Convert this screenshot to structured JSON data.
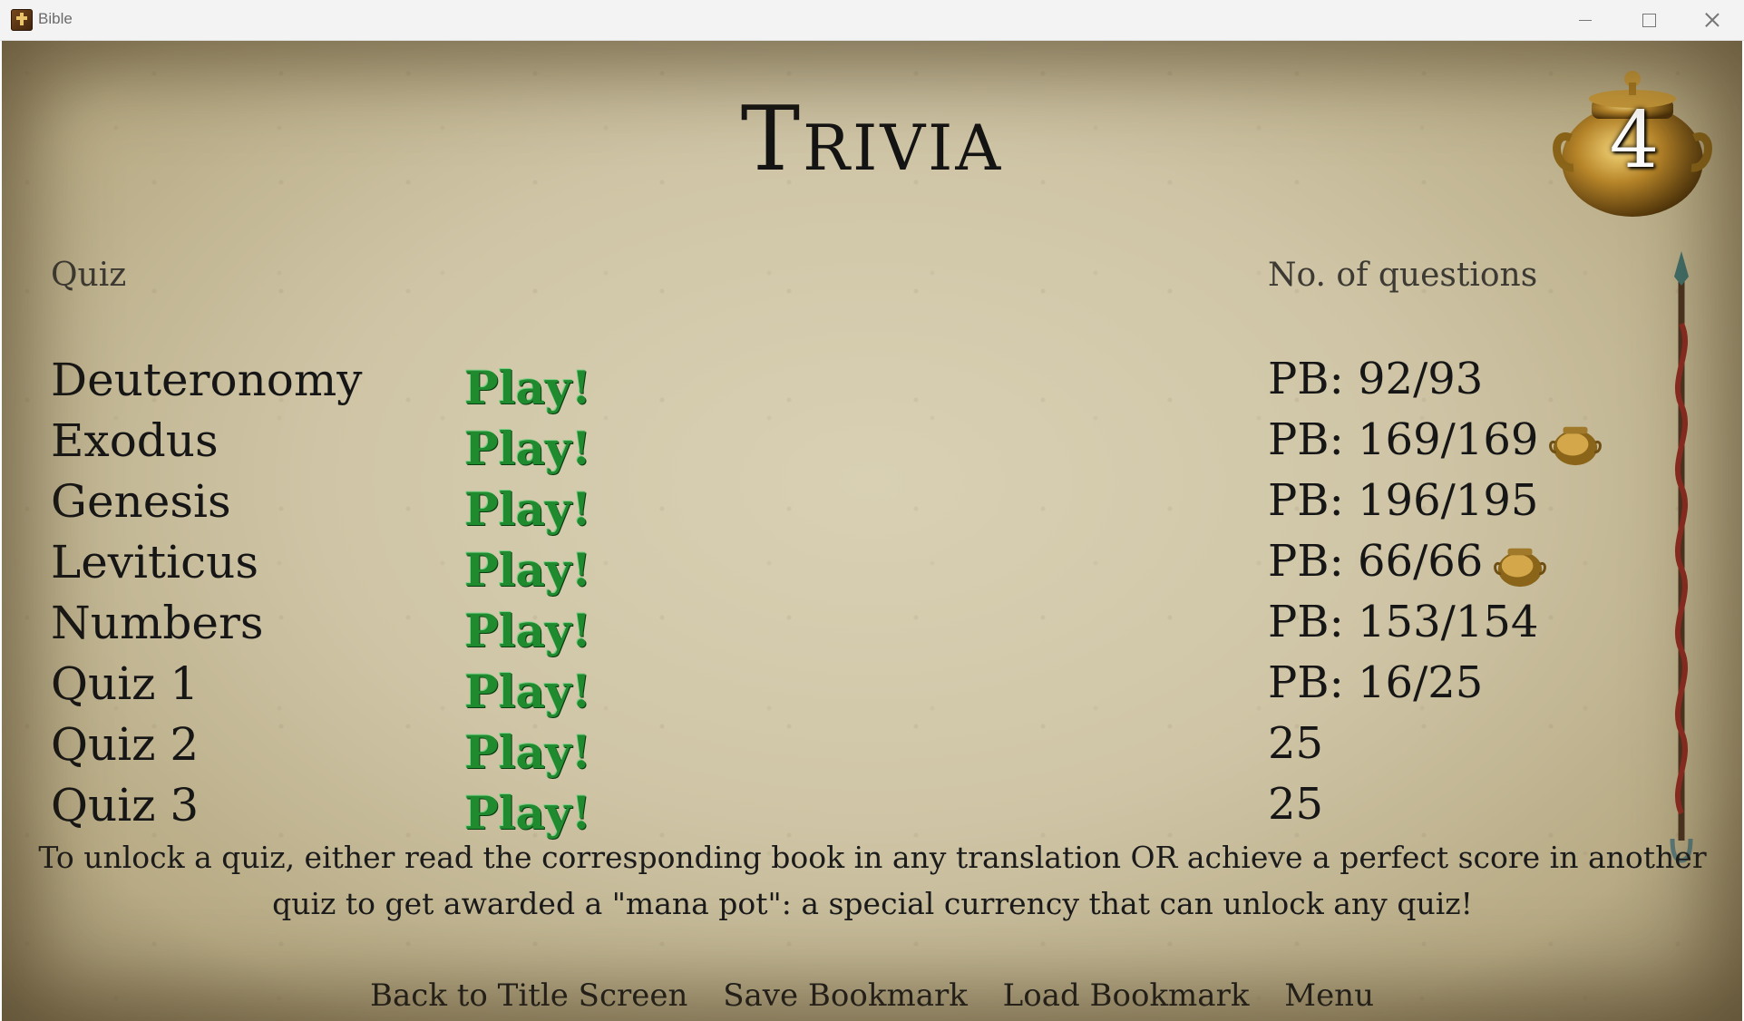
{
  "window": {
    "title": "Bible"
  },
  "screen": {
    "title": "Trivia",
    "mana_pot_count": "4"
  },
  "table": {
    "headers": {
      "quiz": "Quiz",
      "questions": "No. of questions"
    },
    "play_label": "Play!",
    "rows": [
      {
        "name": "Deuteronomy",
        "score": "PB: 92/93",
        "mana_pot_earned": false
      },
      {
        "name": "Exodus",
        "score": "PB: 169/169",
        "mana_pot_earned": true
      },
      {
        "name": "Genesis",
        "score": "PB: 196/195",
        "mana_pot_earned": false
      },
      {
        "name": "Leviticus",
        "score": "PB: 66/66",
        "mana_pot_earned": true
      },
      {
        "name": "Numbers",
        "score": "PB: 153/154",
        "mana_pot_earned": false
      },
      {
        "name": "Quiz 1",
        "score": "PB: 16/25",
        "mana_pot_earned": false
      },
      {
        "name": "Quiz 2",
        "score": "25",
        "mana_pot_earned": false
      },
      {
        "name": "Quiz 3",
        "score": "25",
        "mana_pot_earned": false
      }
    ]
  },
  "unlock_note": "To unlock a quiz, either read the corresponding book in any translation OR achieve a perfect score in another quiz to get awarded a \"mana pot\": a special currency that can unlock any quiz!",
  "footer_menu": {
    "back_to_title": "Back to Title Screen",
    "save_bookmark": "Save Bookmark",
    "load_bookmark": "Load Bookmark",
    "menu": "Menu"
  },
  "colors": {
    "play_green": "#1f8a2e",
    "parchment": "#cfc5a6",
    "text": "#161616"
  },
  "icons": {
    "app": "bible-book-icon",
    "mana_pot": "mana-pot-icon",
    "scroll_thumb": "serpent-staff-icon"
  }
}
